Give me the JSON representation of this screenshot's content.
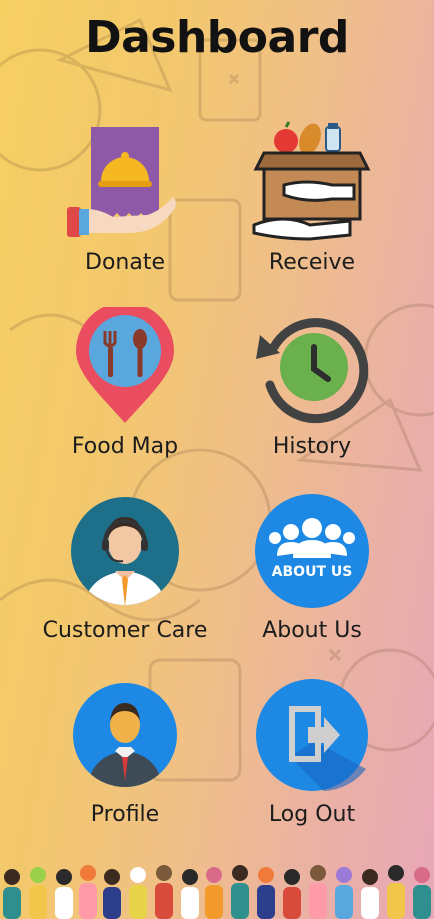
{
  "header": {
    "title": "Dashboard"
  },
  "tiles": [
    {
      "label": "Donate",
      "icon": "donate-icon"
    },
    {
      "label": "Receive",
      "icon": "receive-box-icon"
    },
    {
      "label": "Food Map",
      "icon": "food-map-pin-icon"
    },
    {
      "label": "History",
      "icon": "history-clock-icon"
    },
    {
      "label": "Customer Care",
      "icon": "customer-care-agent-icon"
    },
    {
      "label": "About Us",
      "icon": "about-us-icon"
    },
    {
      "label": "Profile",
      "icon": "profile-avatar-icon"
    },
    {
      "label": "Log Out",
      "icon": "logout-icon"
    }
  ],
  "about_badge_text": "ABOUT US",
  "colors": {
    "accent_blue": "#1e88e5",
    "pin_red": "#e94d5f",
    "clock_green": "#6ab04c",
    "donate_purple": "#8e5aa8"
  }
}
